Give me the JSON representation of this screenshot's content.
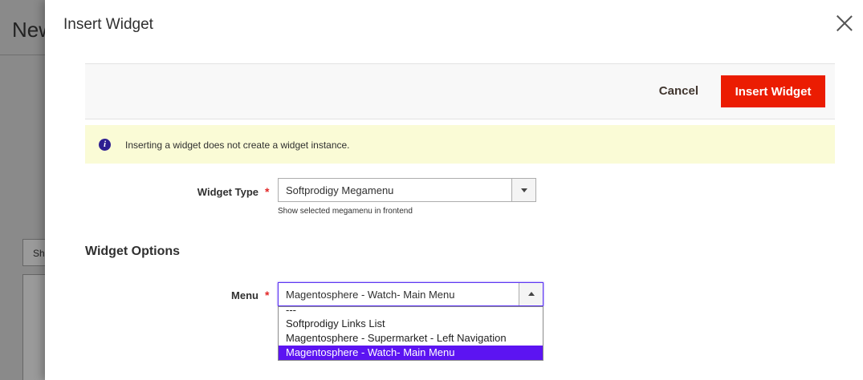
{
  "background": {
    "page_title": "New",
    "button_label": "Sh"
  },
  "modal": {
    "title": "Insert Widget",
    "cancel_label": "Cancel",
    "insert_label": "Insert Widget",
    "notice_icon": "i",
    "notice_text": "Inserting a widget does not create a widget instance."
  },
  "widget_type": {
    "label": "Widget Type",
    "required_mark": "*",
    "value": "Softprodigy Megamenu",
    "hint": "Show selected megamenu in frontend"
  },
  "widget_options": {
    "title": "Widget Options",
    "menu": {
      "label": "Menu",
      "required_mark": "*",
      "value": "Magentosphere - Watch- Main Menu",
      "options": [
        "---",
        "Softprodigy Links List",
        "Magentosphere - Supermarket - Left Navigation",
        "Magentosphere - Watch- Main Menu"
      ]
    }
  },
  "colors": {
    "accent": "#eb1c02",
    "selected_option": "#5c14f2",
    "notice_bg": "#fafbd6"
  }
}
